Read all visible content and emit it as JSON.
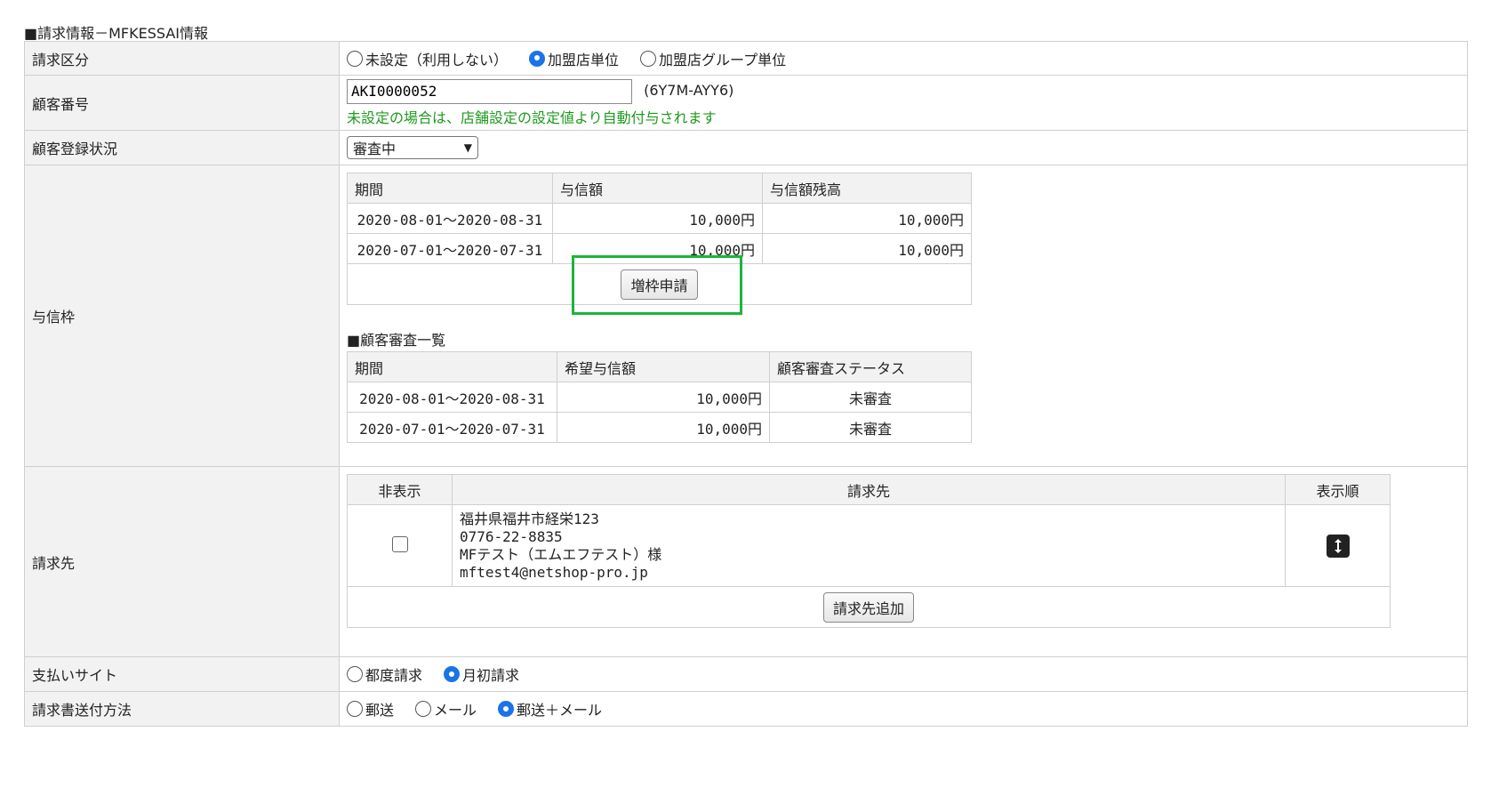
{
  "section_title": "■請求情報－MFKESSAI情報",
  "billing_type": {
    "label": "請求区分",
    "options": [
      "未設定（利用しない）",
      "加盟店単位",
      "加盟店グループ単位"
    ],
    "selected": "加盟店単位"
  },
  "customer_number": {
    "label": "顧客番号",
    "value": "AKI0000052",
    "code": "(6Y7M-AYY6)",
    "hint": "未設定の場合は、店舗設定の設定値より自動付与されます"
  },
  "registration_status": {
    "label": "顧客登録状況",
    "selected": "審査中"
  },
  "credit_limit": {
    "label": "与信枠",
    "columns": [
      "期間",
      "与信額",
      "与信額残高"
    ],
    "rows": [
      {
        "period": "2020-08-01～2020-08-31",
        "amount": "10,000円",
        "balance": "10,000円"
      },
      {
        "period": "2020-07-01～2020-07-31",
        "amount": "10,000円",
        "balance": "10,000円"
      }
    ],
    "increase_button": "増枠申請",
    "review_title": "■顧客審査一覧",
    "review_columns": [
      "期間",
      "希望与信額",
      "顧客審査ステータス"
    ],
    "review_rows": [
      {
        "period": "2020-08-01～2020-08-31",
        "amount": "10,000円",
        "status": "未審査"
      },
      {
        "period": "2020-07-01～2020-07-31",
        "amount": "10,000円",
        "status": "未審査"
      }
    ]
  },
  "billing_to": {
    "label": "請求先",
    "columns": [
      "非表示",
      "請求先",
      "表示順"
    ],
    "entry": {
      "address": "福井県福井市経栄123",
      "phone": "0776-22-8835",
      "name": "MFテスト（エムエフテスト）様",
      "email": "mftest4@netshop-pro.jp",
      "hidden": false
    },
    "add_button": "請求先追加"
  },
  "payment_site": {
    "label": "支払いサイト",
    "options": [
      "都度請求",
      "月初請求"
    ],
    "selected": "月初請求"
  },
  "invoice_delivery": {
    "label": "請求書送付方法",
    "options": [
      "郵送",
      "メール",
      "郵送＋メール"
    ],
    "selected": "郵送＋メール"
  },
  "colors": {
    "accent": "#1a73e8",
    "hint": "#1e9a1e",
    "highlight": "#1bb53a",
    "header_bg": "#f2f2f2"
  }
}
